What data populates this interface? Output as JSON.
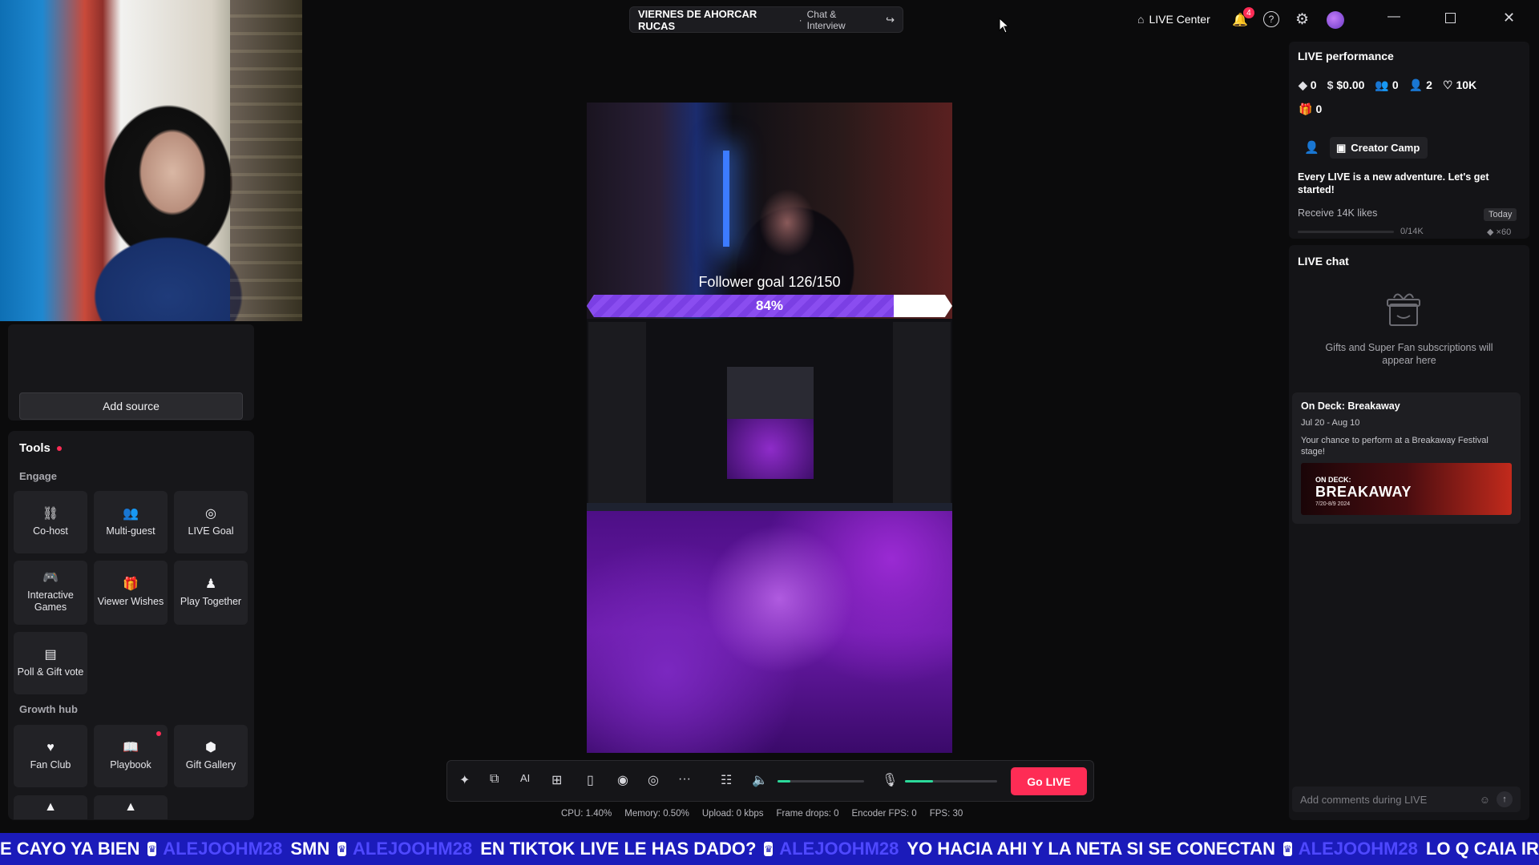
{
  "header": {
    "stream_title": "VIERNES DE AHORCAR RUCAS",
    "category": "Chat & Interview",
    "live_center": "LIVE Center",
    "notification_count": "4"
  },
  "left": {
    "add_source": "Add source",
    "tools_title": "Tools",
    "engage_label": "Engage",
    "growth_label": "Growth hub",
    "engage_tools": [
      {
        "label": "Co-host",
        "icon": "link-icon"
      },
      {
        "label": "Multi-guest",
        "icon": "users-icon"
      },
      {
        "label": "LIVE Goal",
        "icon": "target-icon"
      },
      {
        "label": "Interactive Games",
        "icon": "gamepad-icon"
      },
      {
        "label": "Viewer Wishes",
        "icon": "gift-icon"
      },
      {
        "label": "Play Together",
        "icon": "person-icon"
      },
      {
        "label": "Poll & Gift vote",
        "icon": "poll-icon"
      }
    ],
    "growth_tools": [
      {
        "label": "Fan Club",
        "icon": "heart-icon"
      },
      {
        "label": "Playbook",
        "icon": "playbook-icon"
      },
      {
        "label": "Gift Gallery",
        "icon": "gallery-icon"
      }
    ]
  },
  "preview": {
    "goal_text": "Follower goal 126/150",
    "goal_percent_label": "84%",
    "goal_fraction": 0.84
  },
  "controls": {
    "go_live": "Go LIVE",
    "speaker_volume": 0.15,
    "mic_volume": 0.3
  },
  "stats": {
    "cpu": "CPU: 1.40%",
    "memory": "Memory: 0.50%",
    "upload": "Upload: 0 kbps",
    "frame_drops": "Frame drops: 0",
    "encoder_fps": "Encoder FPS: 0",
    "fps": "FPS: 30"
  },
  "performance": {
    "title": "LIVE performance",
    "diamonds": "0",
    "earnings": "$0.00",
    "viewers": "0",
    "new_followers": "2",
    "likes": "10K",
    "gifters": "0",
    "creator_camp": "Creator Camp",
    "adventure_text": "Every LIVE is a new adventure. Let's get started!",
    "task": "Receive 14K likes",
    "task_when": "Today",
    "task_progress_label": "0/14K",
    "task_progress": 0,
    "task_reward": "×60"
  },
  "chat": {
    "title": "LIVE chat",
    "empty_text": "Gifts and Super Fan subscriptions will appear here",
    "ondeck_title": "On Deck: Breakaway",
    "ondeck_dates": "Jul 20 - Aug 10",
    "ondeck_desc": "Your chance to perform at a Breakaway Festival stage!",
    "banner_small": "ON DECK:",
    "banner_big": "BREAKAWAY",
    "banner_dates": "7/20-8/9 2024",
    "comment_placeholder": "Add comments during LIVE"
  },
  "ticker": {
    "user": "ALEJOOHM28",
    "messages": [
      "E CAYO YA BIEN",
      "SMN",
      "EN TIKTOK LIVE LE HAS DADO?",
      "YO HACIA AHI Y LA NETA SI SE CONECTAN",
      "LO Q CAIA IRL"
    ]
  },
  "colors": {
    "accent": "#fe2c55",
    "goal_fill": "#8a4df0",
    "slider": "#2bd99a",
    "ticker_bg": "#1b1bba"
  }
}
